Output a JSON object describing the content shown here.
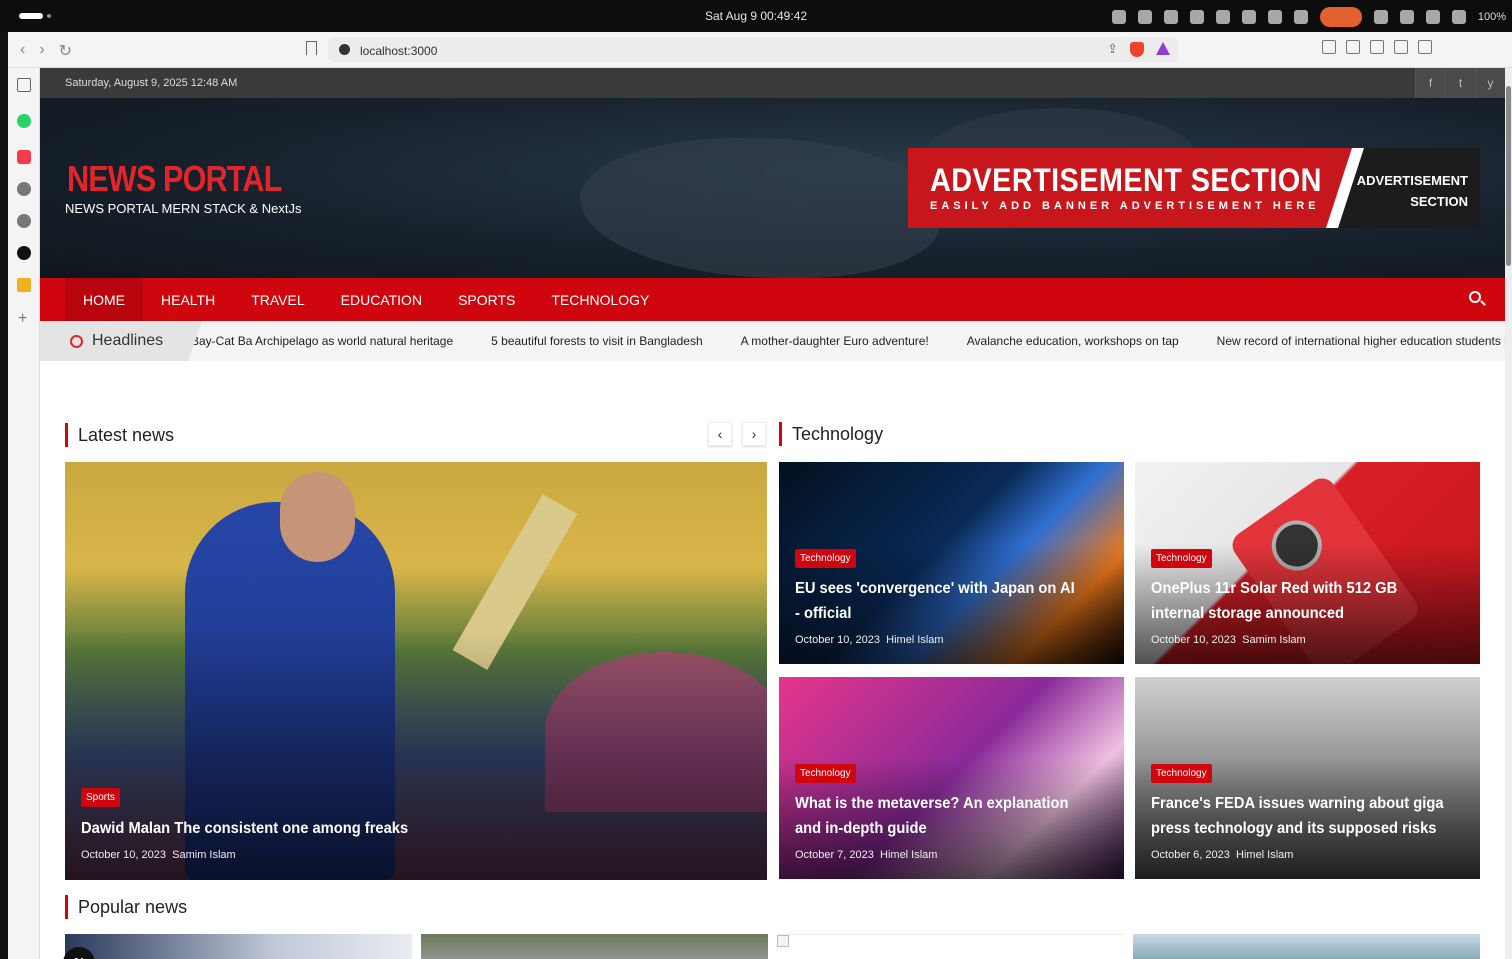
{
  "os": {
    "clock": "Sat Aug 9  00:49:42",
    "battery": "100%"
  },
  "browser": {
    "url": "localhost:3000"
  },
  "site": {
    "date": "Saturday, August 9, 2025 12:48 AM",
    "social": [
      "f",
      "t",
      "y"
    ],
    "logo_title": "NEWS PORTAL",
    "logo_sub": "NEWS PORTAL MERN STACK & NextJs",
    "ad": {
      "title": "ADVERTISEMENT SECTION",
      "tagline": "EASILY ADD BANNER ADVERTISEMENT HERE",
      "side_line1": "ADVERTISEMENT",
      "side_line2": "SECTION"
    },
    "menu": [
      "HOME",
      "HEALTH",
      "TRAVEL",
      "EDUCATION",
      "SPORTS",
      "TECHNOLOGY"
    ],
    "headlines_label": "Headlines",
    "headlines": [
      "g Bay-Cat Ba Archipelago as world natural heritage",
      "5 beautiful forests to visit in Bangladesh",
      "A mother-daughter Euro adventure!",
      "Avalanche education, workshops on tap",
      "New record of international higher education students in Germa"
    ],
    "latest_title": "Latest news",
    "technology_title": "Technology",
    "popular_title": "Popular news",
    "big_card": {
      "tag": "Sports",
      "title": "Dawid Malan The consistent one among freaks",
      "date": "October 10, 2023",
      "author": "Samim Islam"
    },
    "tech_cards": [
      {
        "tag": "Technology",
        "title": "EU sees 'convergence' with Japan on AI - official",
        "date": "October 10, 2023",
        "author": "Himel Islam"
      },
      {
        "tag": "Technology",
        "title": "OnePlus 11r Solar Red with 512 GB internal storage announced",
        "date": "October 10, 2023",
        "author": "Samim Islam"
      },
      {
        "tag": "Technology",
        "title": "What is the metaverse? An explanation and in-depth guide",
        "date": "October 7, 2023",
        "author": "Himel Islam"
      },
      {
        "tag": "Technology",
        "title": "France's FEDA issues warning about giga press technology and its supposed risks",
        "date": "October 6, 2023",
        "author": "Himel Islam"
      }
    ],
    "badge": "N"
  },
  "colors": {
    "accent": "#d0060f",
    "topbar": "#3a3a3a"
  }
}
